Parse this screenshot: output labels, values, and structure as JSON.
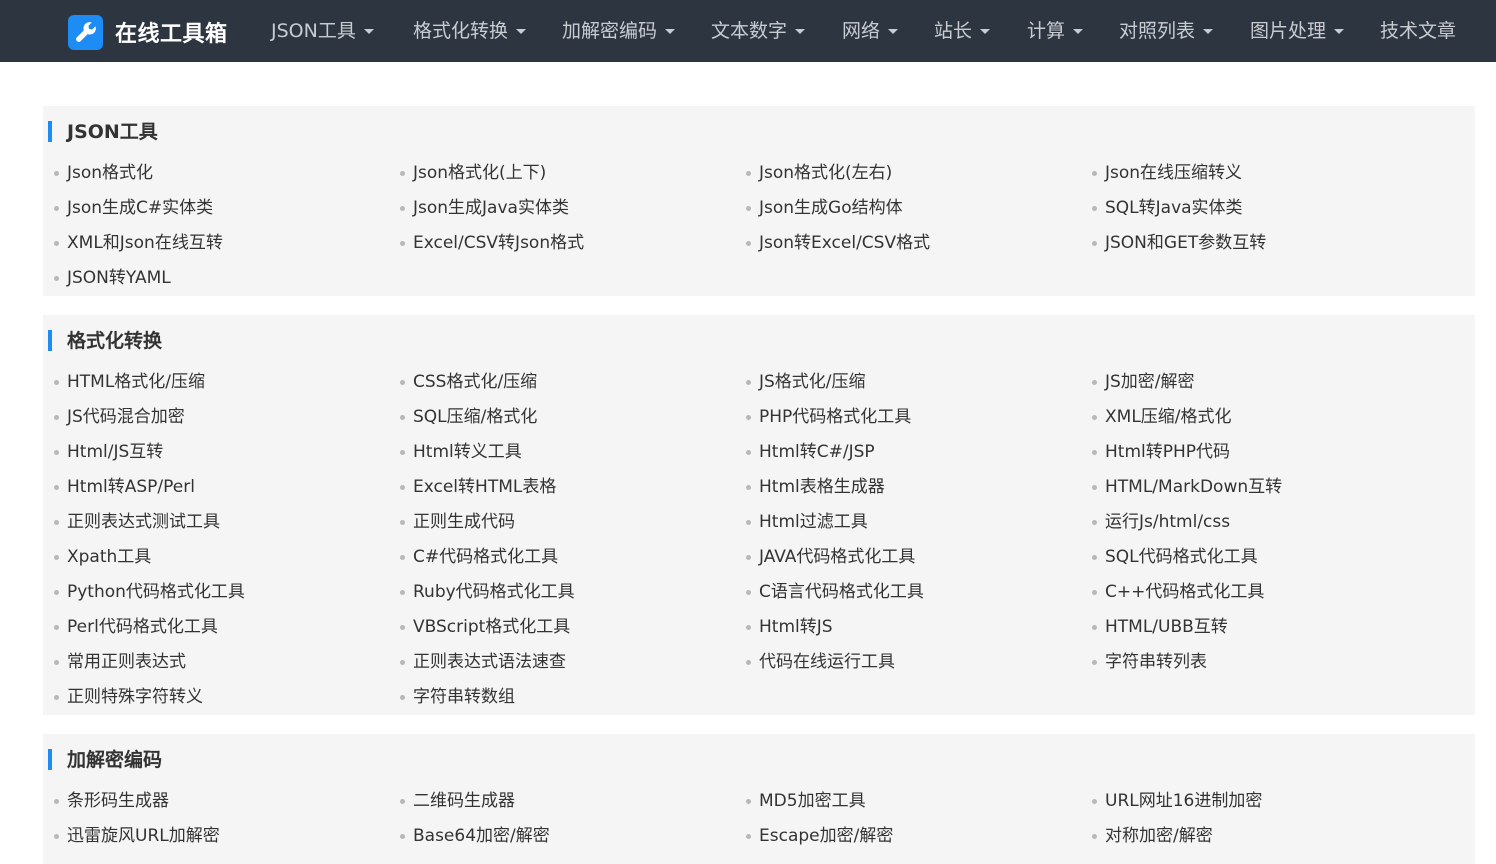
{
  "brand": {
    "name": "在线工具箱",
    "icon": "wrench-icon",
    "color": "#1d8cf5"
  },
  "nav": [
    {
      "label": "JSON工具",
      "dropdown": true
    },
    {
      "label": "格式化转换",
      "dropdown": true
    },
    {
      "label": "加解密编码",
      "dropdown": true
    },
    {
      "label": "文本数字",
      "dropdown": true
    },
    {
      "label": "网络",
      "dropdown": true
    },
    {
      "label": "站长",
      "dropdown": true
    },
    {
      "label": "计算",
      "dropdown": true
    },
    {
      "label": "对照列表",
      "dropdown": true
    },
    {
      "label": "图片处理",
      "dropdown": true
    },
    {
      "label": "技术文章",
      "dropdown": false
    }
  ],
  "sections": [
    {
      "title": "JSON工具",
      "items": [
        "Json格式化",
        "Json格式化(上下)",
        "Json格式化(左右)",
        "Json在线压缩转义",
        "Json生成C#实体类",
        "Json生成Java实体类",
        "Json生成Go结构体",
        "SQL转Java实体类",
        "XML和Json在线互转",
        "Excel/CSV转Json格式",
        "Json转Excel/CSV格式",
        "JSON和GET参数互转",
        "JSON转YAML"
      ]
    },
    {
      "title": "格式化转换",
      "items": [
        "HTML格式化/压缩",
        "CSS格式化/压缩",
        "JS格式化/压缩",
        "JS加密/解密",
        "JS代码混合加密",
        "SQL压缩/格式化",
        "PHP代码格式化工具",
        "XML压缩/格式化",
        "Html/JS互转",
        "Html转义工具",
        "Html转C#/JSP",
        "Html转PHP代码",
        "Html转ASP/Perl",
        "Excel转HTML表格",
        "Html表格生成器",
        "HTML/MarkDown互转",
        "正则表达式测试工具",
        "正则生成代码",
        "Html过滤工具",
        "运行Js/html/css",
        "Xpath工具",
        "C#代码格式化工具",
        "JAVA代码格式化工具",
        "SQL代码格式化工具",
        "Python代码格式化工具",
        "Ruby代码格式化工具",
        "C语言代码格式化工具",
        "C++代码格式化工具",
        "Perl代码格式化工具",
        "VBScript格式化工具",
        "Html转JS",
        "HTML/UBB互转",
        "常用正则表达式",
        "正则表达式语法速查",
        "代码在线运行工具",
        "字符串转列表",
        "正则特殊字符转义",
        "字符串转数组"
      ]
    },
    {
      "title": "加解密编码",
      "items": [
        "条形码生成器",
        "二维码生成器",
        "MD5加密工具",
        "URL网址16进制加密",
        "迅雷旋风URL加解密",
        "Base64加密/解密",
        "Escape加密/解密",
        "对称加密/解密"
      ]
    }
  ]
}
